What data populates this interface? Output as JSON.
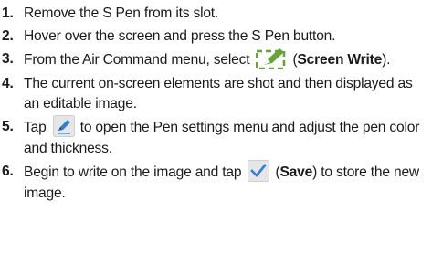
{
  "steps": [
    {
      "number": "1.",
      "text": "Remove the S Pen from its slot."
    },
    {
      "number": "2.",
      "text": "Hover over the screen and press the S Pen button."
    },
    {
      "number": "3.",
      "before": "From the Air Command menu, select",
      "bold": "Screen Write",
      "icon": "screen-write-icon"
    },
    {
      "number": "4.",
      "text": "The current on-screen elements are shot and then displayed as an editable image."
    },
    {
      "number": "5.",
      "before": "Tap",
      "after": "to open the Pen settings menu and adjust the pen color and thickness.",
      "icon": "pen-settings-icon"
    },
    {
      "number": "6.",
      "before": "Begin to write on the image and tap",
      "bold": "Save",
      "after": "to store the new image.",
      "icon": "checkmark-icon"
    }
  ],
  "colors": {
    "icon_green": "#67a33a",
    "icon_blue": "#2f7ed8",
    "icon_tile": "#e6e6e6"
  }
}
